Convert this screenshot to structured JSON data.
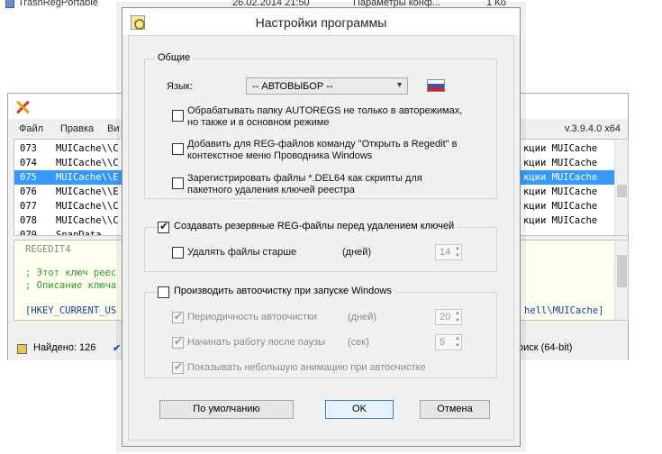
{
  "explorer": {
    "filename": "TrashRegPortable",
    "date": "26.02.2014 21:50",
    "type": "Параметры конф...",
    "size": "1 Кб"
  },
  "bgapp": {
    "menu": [
      "Файл",
      "Правка",
      "Ви"
    ],
    "version": "v.3.9.4.0 x64",
    "rows": [
      {
        "num": "073",
        "key": "MUICache\\\\C",
        "right": "кции MUICache"
      },
      {
        "num": "074",
        "key": "MUICache\\\\C",
        "right": "кции MUICache"
      },
      {
        "num": "075",
        "key": "MUICache\\\\E",
        "right": "кции MUICache"
      },
      {
        "num": "076",
        "key": "MUICache\\\\E",
        "right": "кции MUICache"
      },
      {
        "num": "077",
        "key": "MUICache\\\\C",
        "right": "кции MUICache"
      },
      {
        "num": "078",
        "key": "MUICache\\\\C",
        "right": "кции MUICache"
      },
      {
        "num": "079",
        "key": "SnapData",
        "right": ""
      }
    ],
    "selected_row": 2,
    "editor": {
      "line1": "REGEDIT4",
      "line2": "; Этот ключ реес",
      "line3": "; Описание ключа",
      "line4": "[HKEY_CURRENT_US",
      "line4_right": "hell\\MUICache]"
    },
    "status_found": "Найдено: 126",
    "status_right": "поиск (64-bit)"
  },
  "dialog": {
    "title": "Настройки программы",
    "general": {
      "caption": "Общие",
      "language_label": "Язык:",
      "language_value": "-- АВТОВЫБОР --",
      "opt1_line1": "Обрабатывать папку AUTOREGS не только в авторежимах,",
      "opt1_line2": "но также и в основном режиме",
      "opt1_checked": false,
      "opt2_line1": "Добавить для REG-файлов команду \"Открыть в Regedit\" в",
      "opt2_line2": "контекстное меню Проводника Windows",
      "opt2_checked": false,
      "opt3_line1": "Зарегистрировать файлы *.DEL64 как скрипты для",
      "opt3_line2": "пакетного удаления ключей реестра",
      "opt3_checked": false
    },
    "backup": {
      "caption": "Создавать резервные REG-файлы перед удалением ключей",
      "checked": true,
      "delete_label": "Удалять файлы старше",
      "delete_checked": false,
      "delete_unit": "(дней)",
      "delete_value": "14"
    },
    "autoclean": {
      "caption": "Производить автоочистку при запуске Windows",
      "checked": false,
      "period_label": "Периодичность автоочистки",
      "period_unit": "(дней)",
      "period_value": "20",
      "pause_label": "Начинать работу после паузы",
      "pause_unit": "(сек)",
      "pause_value": "5",
      "anim_label": "Показывать небольшую анимацию при автоочистке"
    },
    "buttons": {
      "default": "По умолчанию",
      "ok": "OK",
      "cancel": "Отмена"
    }
  }
}
